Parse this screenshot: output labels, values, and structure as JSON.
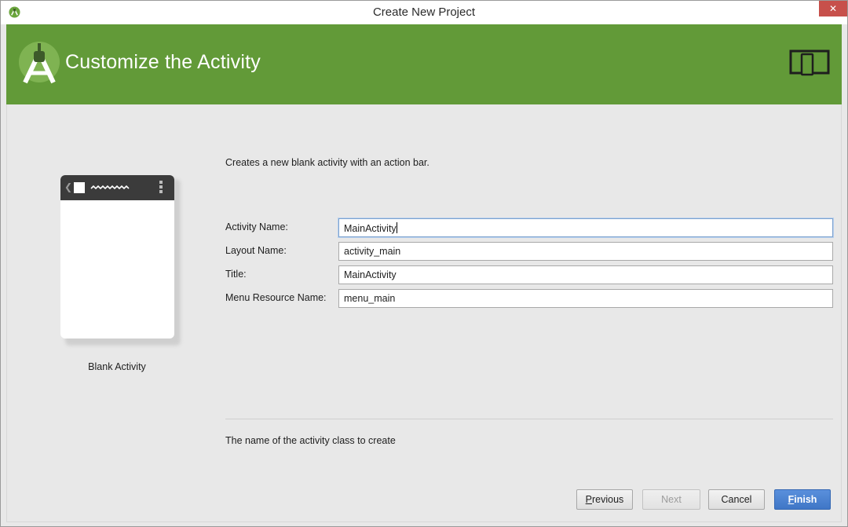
{
  "window": {
    "title": "Create New Project",
    "close_glyph": "✕"
  },
  "header": {
    "heading": "Customize the Activity",
    "logo_icon": "android-studio-icon",
    "device_icon": "device-preview-icon",
    "color": "#629a38"
  },
  "preview": {
    "template_label": "Blank Activity"
  },
  "form": {
    "description": "Creates a new blank activity with an action bar.",
    "fields": [
      {
        "label": "Activity Name:",
        "value": "MainActivity"
      },
      {
        "label": "Layout Name:",
        "value": "activity_main"
      },
      {
        "label": "Title:",
        "value": "MainActivity"
      },
      {
        "label": "Menu Resource Name:",
        "value": "menu_main"
      }
    ],
    "help_text": "The name of the activity class to create"
  },
  "buttons": {
    "previous_first": "P",
    "previous_rest": "revious",
    "next": "Next",
    "cancel": "Cancel",
    "finish_first": "F",
    "finish_rest": "inish",
    "primary_color": "#4a82d2"
  }
}
